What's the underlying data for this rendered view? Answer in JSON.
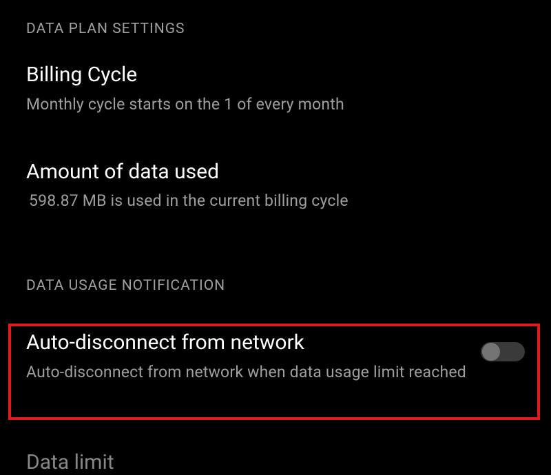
{
  "sections": {
    "dataPlan": {
      "header": "DATA PLAN SETTINGS",
      "billingCycle": {
        "title": "Billing Cycle",
        "subtitle": "Monthly cycle starts on the 1 of every month"
      },
      "amountUsed": {
        "title": "Amount of data used",
        "subtitle": "598.87 MB is used in the current billing cycle"
      }
    },
    "dataUsageNotification": {
      "header": "DATA USAGE NOTIFICATION",
      "autoDisconnect": {
        "title": "Auto-disconnect from network",
        "subtitle": "Auto-disconnect from network when data usage limit reached",
        "enabled": false
      },
      "dataLimit": {
        "title": "Data limit"
      }
    }
  }
}
